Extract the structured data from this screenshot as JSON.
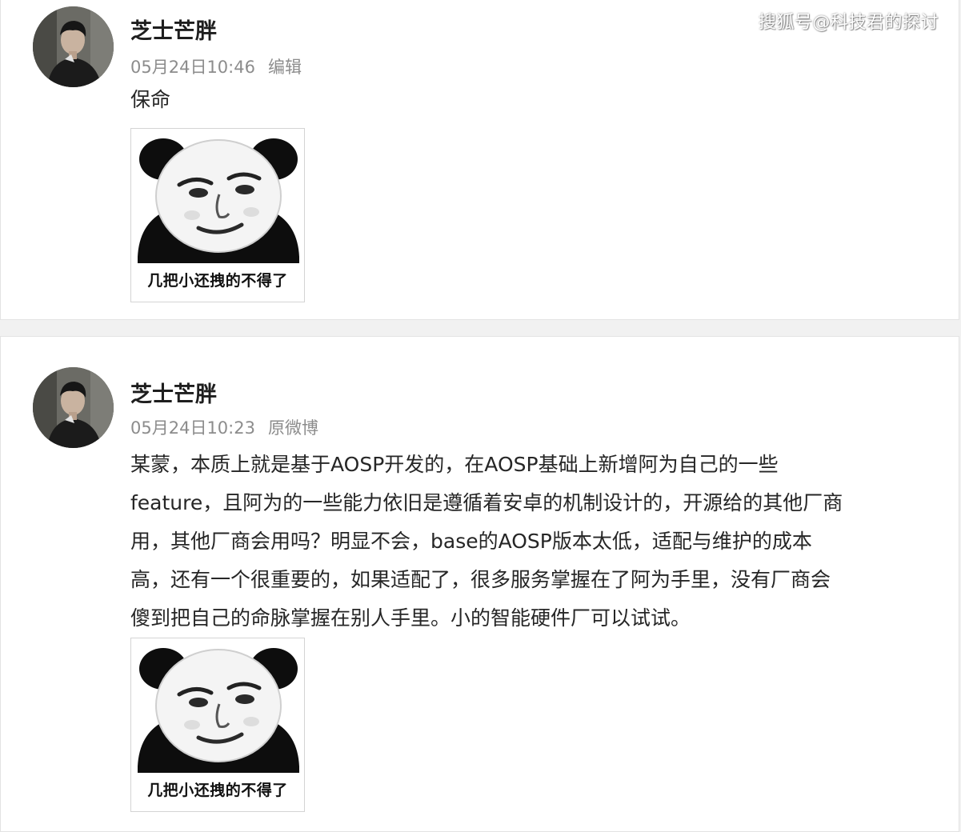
{
  "watermark": "搜狐号@科技君的探讨",
  "posts": [
    {
      "username": "芝士芒胖",
      "time": "05月24日10:46",
      "action": "编辑",
      "content_lines": [
        "保命"
      ],
      "sticker_caption": "几把小还拽的不得了"
    },
    {
      "username": "芝士芒胖",
      "time": "05月24日10:23",
      "action": "原微博",
      "content_lines": [
        "某蒙，本质上就是基于AOSP开发的，在AOSP基础上新增阿为自己的一些",
        "feature，且阿为的一些能力依旧是遵循着安卓的机制设计的，开源给的其他厂商",
        "用，其他厂商会用吗？明显不会，base的AOSP版本太低，适配与维护的成本",
        "高，还有一个很重要的，如果适配了，很多服务掌握在了阿为手里，没有厂商会",
        "傻到把自己的命脉掌握在别人手里。小的智能硬件厂可以试试。"
      ],
      "sticker_caption": "几把小还拽的不得了"
    }
  ],
  "colors": {
    "page_bg": "#f1f1f1",
    "card_bg": "#ffffff",
    "username": "#1e1e1e",
    "meta": "#8c8c8c",
    "text": "#262626"
  },
  "icons": {
    "avatar": "user-photo",
    "sticker": "panda-face-meme"
  }
}
